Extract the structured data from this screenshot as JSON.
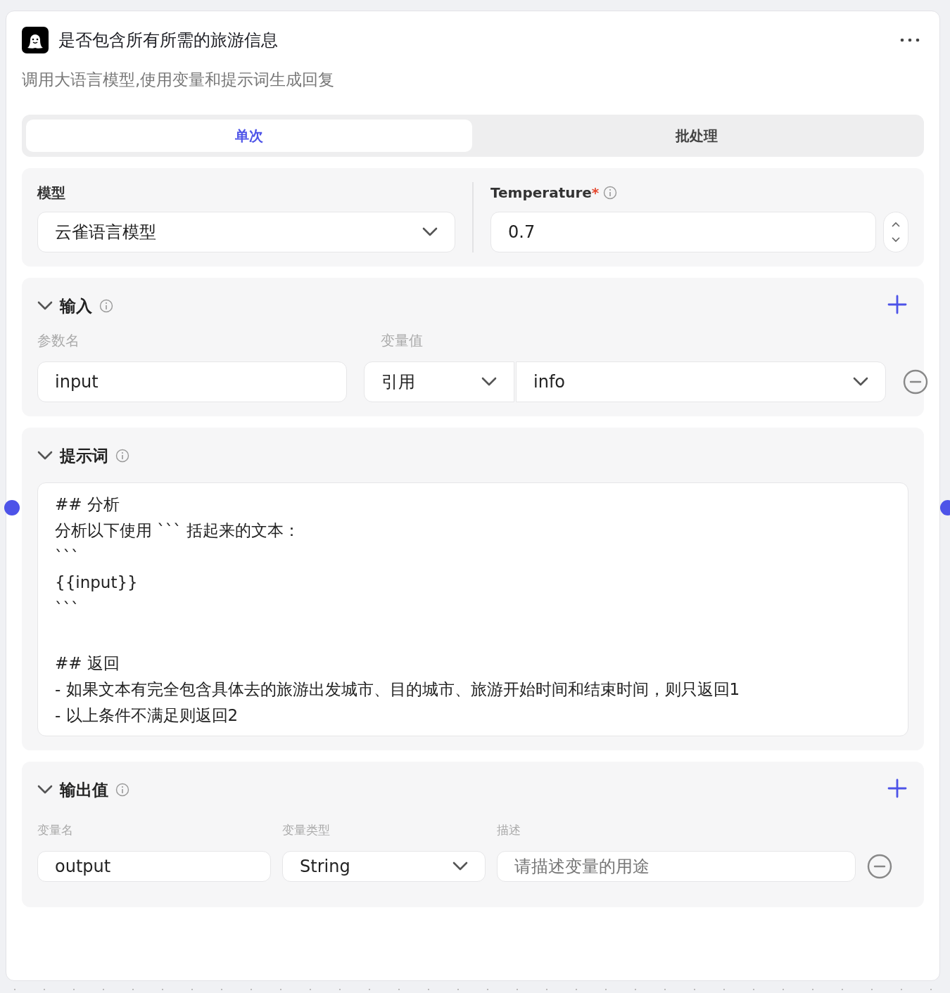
{
  "node": {
    "title": "是否包含所有所需的旅游信息",
    "description": "调用大语言模型,使用变量和提示词生成回复"
  },
  "tabs": [
    {
      "label": "单次",
      "selected": true
    },
    {
      "label": "批处理",
      "selected": false
    }
  ],
  "model": {
    "label": "模型",
    "value": "云雀语言模型"
  },
  "temperature": {
    "label": "Temperature",
    "required_mark": "*",
    "value": "0.7"
  },
  "input": {
    "title": "输入",
    "expanded": true,
    "columns": [
      "参数名",
      "变量值"
    ],
    "rows": [
      {
        "name": "input",
        "source": "引用",
        "value": "info"
      }
    ]
  },
  "prompt": {
    "title": "提示词",
    "expanded": true,
    "lines": [
      {
        "text": "## 分析",
        "blank_before": false
      },
      {
        "text": "分析以下使用 ``` 括起来的文本：",
        "blank_before": false
      },
      {
        "text": "```",
        "blank_before": false
      },
      {
        "text": "{{input}}",
        "blank_before": false
      },
      {
        "text": "```",
        "blank_before": false
      },
      {
        "text": "## 返回",
        "blank_before": true
      },
      {
        "text": "- 如果文本有完全包含具体去的旅游出发城市、目的城市、旅游开始时间和结束时间，则只返回1",
        "blank_before": false
      },
      {
        "text": "- 以上条件不满足则返回2",
        "blank_before": false
      }
    ]
  },
  "output": {
    "title": "输出值",
    "expanded": true,
    "columns": [
      "变量名",
      "变量类型",
      "描述"
    ],
    "rows": [
      {
        "name": "output",
        "type": "String",
        "placeholder": "请描述变量的用途"
      }
    ]
  }
}
